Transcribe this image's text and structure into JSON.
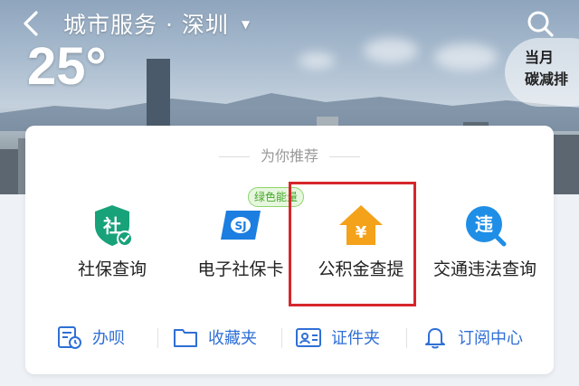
{
  "header": {
    "city_title": "城市服务 · 深圳",
    "dropdown_caret": "▼",
    "temperature": "25°",
    "carbon_badge": {
      "line1": "当月",
      "line2": "碳减排"
    }
  },
  "recommend": {
    "heading": "为你推荐",
    "items": [
      {
        "label": "社保查询",
        "icon": "shield-social-icon",
        "color": "#17a27a"
      },
      {
        "label": "电子社保卡",
        "icon": "social-card-icon",
        "color": "#1b7ee0",
        "badge": "绿色能量"
      },
      {
        "label": "公积金查提",
        "icon": "house-fund-icon",
        "color": "#f4a21a"
      },
      {
        "label": "交通违法查询",
        "icon": "traffic-violation-icon",
        "color": "#1f8ee6"
      }
    ]
  },
  "quick_links": [
    {
      "label": "办呗",
      "icon": "task-list-icon"
    },
    {
      "label": "收藏夹",
      "icon": "folder-icon"
    },
    {
      "label": "证件夹",
      "icon": "id-card-icon"
    },
    {
      "label": "订阅中心",
      "icon": "bell-icon"
    }
  ],
  "colors": {
    "accent": "#2f6fd6",
    "highlight": "#d6262c"
  }
}
